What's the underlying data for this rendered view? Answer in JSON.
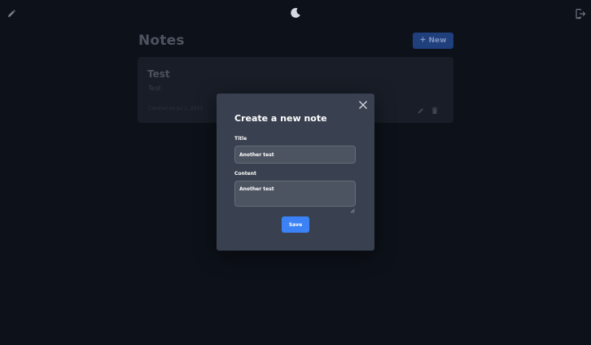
{
  "topbar": {
    "left_icon": "pencil-icon",
    "center_icon": "moon-icon",
    "right_icon": "logout-icon"
  },
  "header": {
    "title": "Notes",
    "new_button_label": "New",
    "new_button_icon": "plus-icon"
  },
  "notes": [
    {
      "title": "Test",
      "content": "Test",
      "date": "Created on Jul 1, 2023"
    }
  ],
  "modal": {
    "title": "Create a new note",
    "title_label": "Title",
    "title_value": "Another test",
    "content_label": "Content",
    "content_value": "Another test",
    "save_label": "Save"
  },
  "colors": {
    "background": "#0d1119",
    "modal": "#394150",
    "accent": "#3b82f6"
  }
}
